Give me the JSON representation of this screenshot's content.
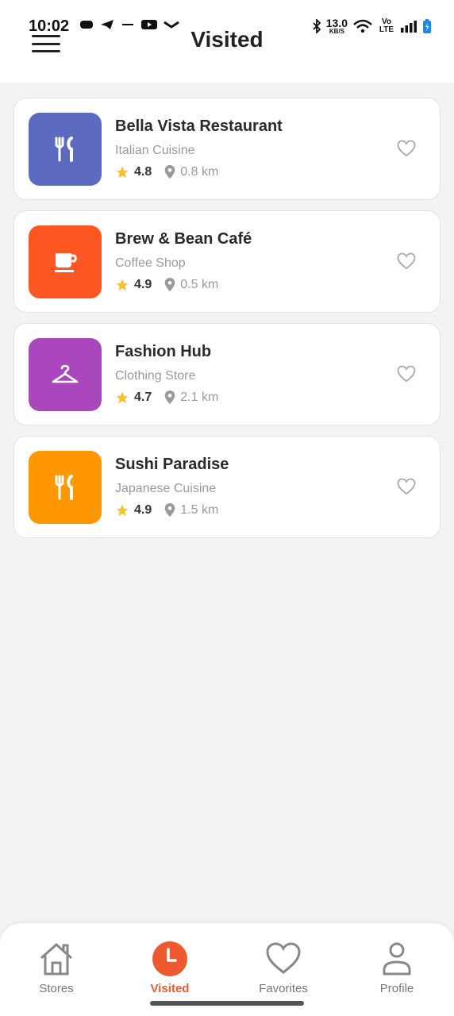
{
  "status_bar": {
    "time": "10:02",
    "network_speed": "13.0",
    "network_unit": "KB/S",
    "volte": "Vo LTE"
  },
  "header": {
    "title": "Visited"
  },
  "stores": [
    {
      "name": "Bella Vista Restaurant",
      "category": "Italian Cuisine",
      "rating": "4.8",
      "distance": "0.8 km",
      "icon": "restaurant-icon",
      "color": "#5c6bc0"
    },
    {
      "name": "Brew & Bean Café",
      "category": "Coffee Shop",
      "rating": "4.9",
      "distance": "0.5 km",
      "icon": "coffee-icon",
      "color": "#ff5722"
    },
    {
      "name": "Fashion Hub",
      "category": "Clothing Store",
      "rating": "4.7",
      "distance": "2.1 km",
      "icon": "hanger-icon",
      "color": "#ab47bc"
    },
    {
      "name": "Sushi Paradise",
      "category": "Japanese Cuisine",
      "rating": "4.9",
      "distance": "1.5 km",
      "icon": "restaurant-icon",
      "color": "#ff9800"
    }
  ],
  "bottom_nav": {
    "items": [
      {
        "label": "Stores",
        "icon": "home-icon",
        "active": false
      },
      {
        "label": "Visited",
        "icon": "clock-icon",
        "active": true
      },
      {
        "label": "Favorites",
        "icon": "heart-icon",
        "active": false
      },
      {
        "label": "Profile",
        "icon": "person-icon",
        "active": false
      }
    ]
  },
  "colors": {
    "accent": "#ee5a2f",
    "star": "#fbc02d"
  }
}
